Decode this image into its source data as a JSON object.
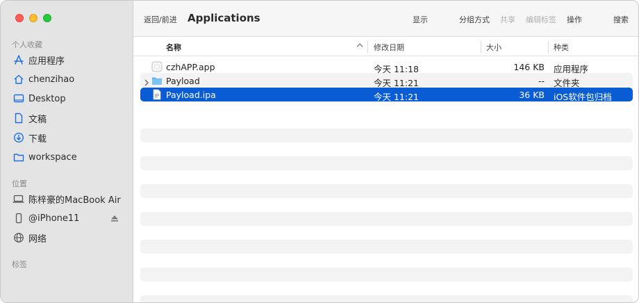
{
  "sidebar": {
    "sections": {
      "favorites": "个人收藏",
      "locations": "位置",
      "tags": "标签"
    },
    "favorites": [
      {
        "label": "应用程序",
        "icon": "applications-icon"
      },
      {
        "label": "chenzihao",
        "icon": "home-icon"
      },
      {
        "label": "Desktop",
        "icon": "desktop-icon"
      },
      {
        "label": "文稿",
        "icon": "document-icon"
      },
      {
        "label": "下载",
        "icon": "downloads-icon"
      },
      {
        "label": "workspace",
        "icon": "folder-icon"
      }
    ],
    "locations": [
      {
        "label": "陈梓豪的MacBook Air",
        "icon": "laptop-icon"
      },
      {
        "label": "@iPhone11",
        "icon": "phone-icon"
      },
      {
        "label": "网络",
        "icon": "network-icon"
      }
    ]
  },
  "toolbar": {
    "back_forward": "返回/前进",
    "title": "Applications",
    "view": "显示",
    "group": "分组方式",
    "share": "共享",
    "edit_tags": "编辑标签",
    "action": "操作",
    "search": "搜索"
  },
  "columns": {
    "name": "名称",
    "date": "修改日期",
    "size": "大小",
    "kind": "种类"
  },
  "files": [
    {
      "name": "czhAPP.app",
      "date": "今天 11:18",
      "size": "146 KB",
      "kind": "应用程序",
      "icon": "app-icon"
    },
    {
      "name": "Payload",
      "date": "今天 11:21",
      "size": "--",
      "kind": "文件夹",
      "icon": "folder-icon"
    },
    {
      "name": "Payload.ipa",
      "date": "今天 11:21",
      "size": "36 KB",
      "kind": "iOS软件包归档",
      "icon": "file-icon"
    }
  ],
  "colors": {
    "selection": "#0a5cd5",
    "sidebar_bg": "#e4e4e4",
    "accent": "#1a6fe0"
  }
}
